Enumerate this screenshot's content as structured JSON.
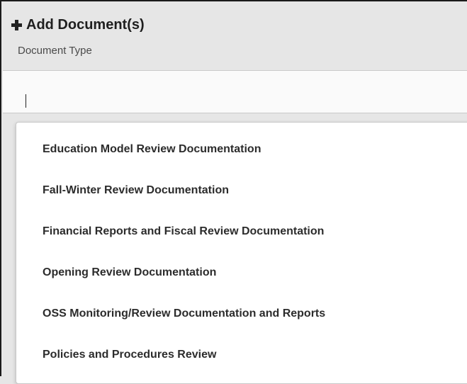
{
  "dialog": {
    "title": "Add Document(s)",
    "document_type_label": "Document Type"
  },
  "document_type_input": {
    "value": ""
  },
  "dropdown": {
    "options": [
      "Education Model Review Documentation",
      "Fall-Winter Review Documentation",
      "Financial Reports and Fiscal Review Documentation",
      "Opening Review Documentation",
      "OSS Monitoring/Review Documentation and Reports",
      "Policies and Procedures Review"
    ]
  }
}
